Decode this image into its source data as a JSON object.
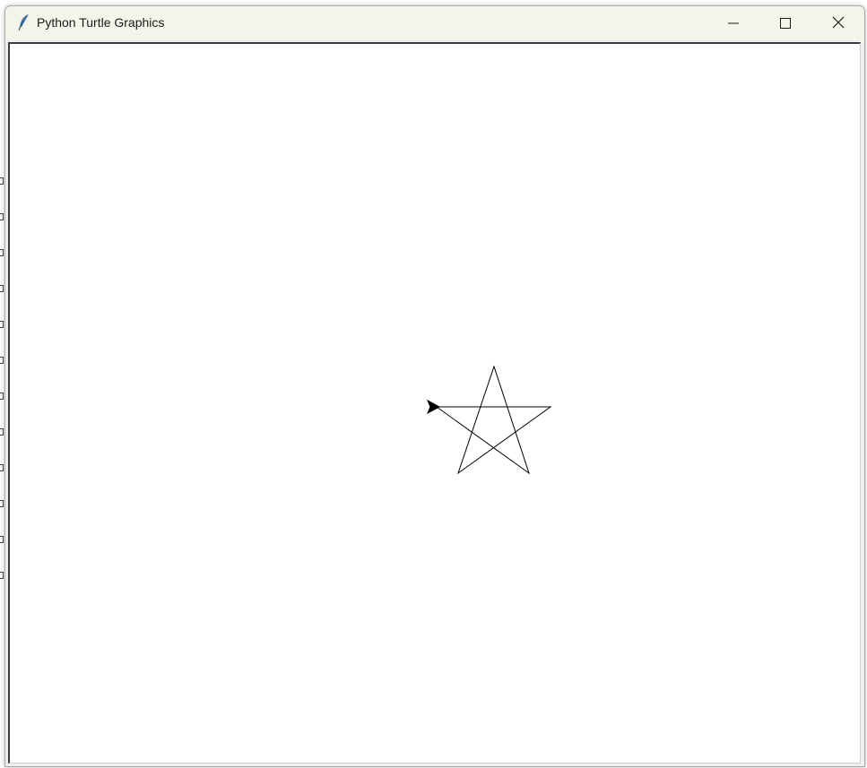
{
  "window": {
    "title": "Python Turtle Graphics",
    "app_icon": "feather-icon",
    "controls": {
      "minimize_icon": "minimize-icon",
      "maximize_icon": "maximize-icon",
      "close_icon": "close-icon"
    }
  },
  "canvas": {
    "background": "#ffffff",
    "pen_color": "#000000",
    "drawing": "star",
    "turtle_cursor": "turtle-arrow-icon",
    "turtle_heading": "east"
  }
}
